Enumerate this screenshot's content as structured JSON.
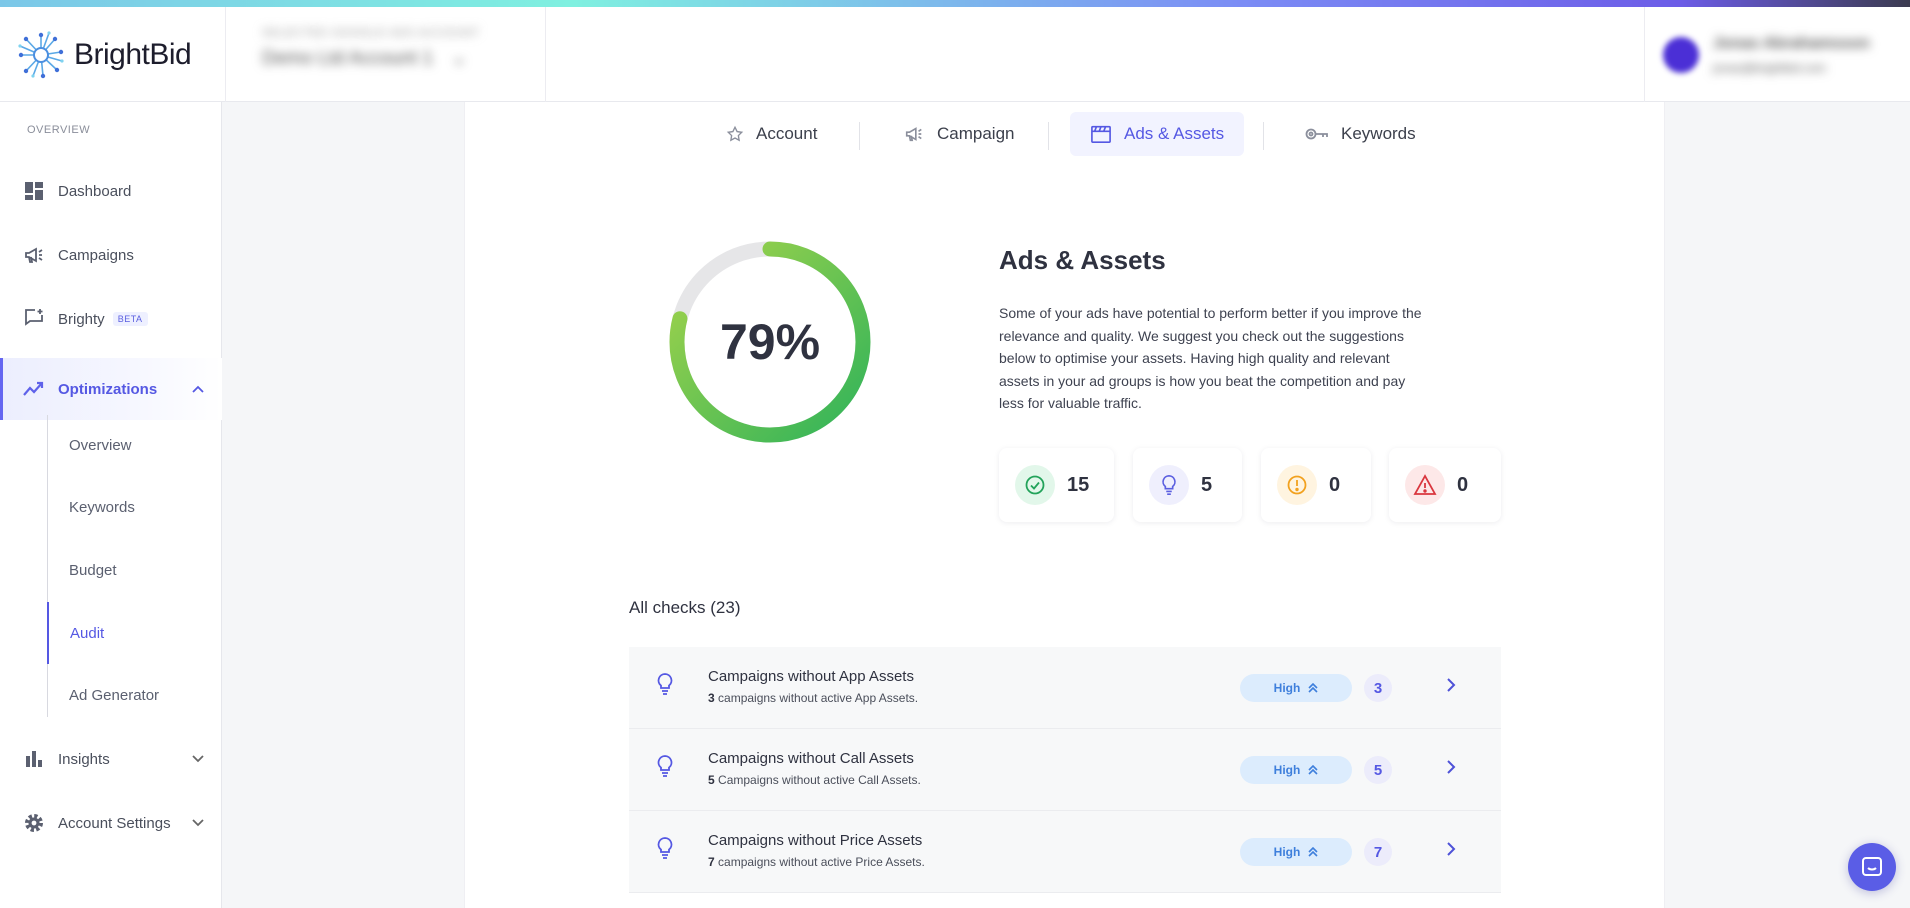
{
  "brand": {
    "logo_text": "BrightBid"
  },
  "header": {
    "account_label": "SELECTED GOOGLE ADS ACCOUNT",
    "account_name": "Demo Ltd Account 1",
    "user_name": "Jonas Abrahamsson",
    "user_email": "jonas@brightbid.com"
  },
  "sidebar": {
    "section": "OVERVIEW",
    "items": [
      {
        "label": "Dashboard",
        "icon": "dashboard-icon"
      },
      {
        "label": "Campaigns",
        "icon": "megaphone-icon"
      },
      {
        "label": "Brighty",
        "icon": "chat-sparkle-icon",
        "badge": "BETA"
      },
      {
        "label": "Optimizations",
        "icon": "trend-icon"
      }
    ],
    "sub_items": [
      "Overview",
      "Keywords",
      "Budget",
      "Audit",
      "Ad Generator"
    ],
    "bottom_items": [
      {
        "label": "Insights",
        "icon": "bar-chart-icon"
      },
      {
        "label": "Account Settings",
        "icon": "gear-icon"
      }
    ]
  },
  "tabs": [
    {
      "label": "Account",
      "icon": "star-icon"
    },
    {
      "label": "Campaign",
      "icon": "megaphone-icon"
    },
    {
      "label": "Ads & Assets",
      "icon": "clapper-icon"
    },
    {
      "label": "Keywords",
      "icon": "key-icon"
    }
  ],
  "score": {
    "label": "79%",
    "value": 0.79,
    "colors": {
      "start": "#2fb35a",
      "end": "#a6d44a",
      "track": "#e6e6e8"
    }
  },
  "section": {
    "title": "Ads & Assets",
    "description": "Some of your ads have potential to perform better if you improve the relevance and quality. We suggest you check out the suggestions below to optimise your assets. Having high quality and relevant assets in your ad groups is how you beat the competition and pay less for valuable traffic."
  },
  "stats": [
    {
      "value": "15",
      "icon": "check-circle-icon",
      "color": "#22a35a",
      "bg": "#e2f7ea"
    },
    {
      "value": "5",
      "icon": "bulb-icon",
      "color": "#5b5fe0",
      "bg": "#efeffd"
    },
    {
      "value": "0",
      "icon": "alert-circle-icon",
      "color": "#f2a11e",
      "bg": "#fff4e0"
    },
    {
      "value": "0",
      "icon": "warning-icon",
      "color": "#d9363e",
      "bg": "#fde8e8"
    }
  ],
  "checks": {
    "title": "All checks (23)",
    "rows": [
      {
        "title": "Campaigns without App Assets",
        "count_text": "3",
        "sub": " campaigns without active App Assets.",
        "priority": "High",
        "count": "3"
      },
      {
        "title": "Campaigns without Call Assets",
        "count_text": "5",
        "sub": " Campaigns without active Call Assets.",
        "priority": "High",
        "count": "5"
      },
      {
        "title": "Campaigns without Price Assets",
        "count_text": "7",
        "sub": " campaigns without active Price Assets.",
        "priority": "High",
        "count": "7"
      }
    ]
  }
}
